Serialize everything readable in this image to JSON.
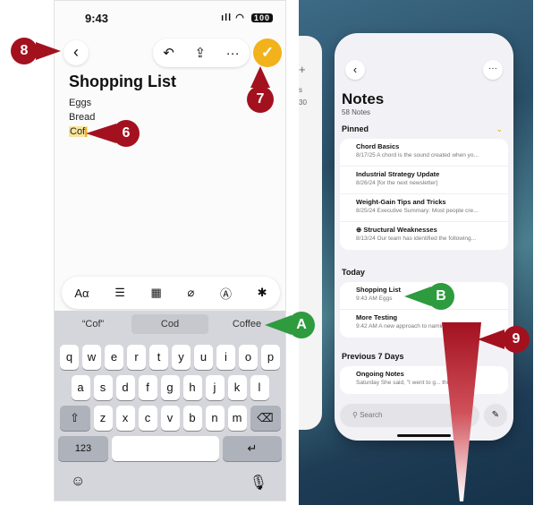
{
  "status": {
    "time": "9:43",
    "signal": "ıll",
    "wifi": "◠",
    "battery": "100"
  },
  "note": {
    "title": "Shopping List",
    "lines": [
      "Eggs",
      "Bread",
      "Cof"
    ]
  },
  "toolbar": {
    "undo_glyph": "↶",
    "share_glyph": "⇪",
    "more_glyph": "···",
    "done_glyph": "✓",
    "back_glyph": "‹"
  },
  "format_bar": {
    "aa": "Aα",
    "list_glyph": "☰",
    "table_glyph": "▦",
    "attach_glyph": "⌀",
    "markup_glyph": "Ⓐ",
    "ai_glyph": "✱"
  },
  "predictions": [
    "“Cof”",
    "Cod",
    "Coffee"
  ],
  "keyboard": {
    "row1": [
      "q",
      "w",
      "e",
      "r",
      "t",
      "y",
      "u",
      "i",
      "o",
      "p"
    ],
    "row2": [
      "a",
      "s",
      "d",
      "f",
      "g",
      "h",
      "j",
      "k",
      "l"
    ],
    "row3": [
      "z",
      "x",
      "c",
      "v",
      "b",
      "n",
      "m"
    ],
    "shift_glyph": "⇧",
    "delete_glyph": "⌫",
    "numbers_label": "123",
    "return_glyph": "↵",
    "emoji_glyph": "☺",
    "mic_glyph": "🎙"
  },
  "notes_app": {
    "title": "Notes",
    "count": "58 Notes",
    "pinned_label": "Pinned",
    "today_label": "Today",
    "prev7_label": "Previous 7 Days",
    "search_placeholder": "Search",
    "pinned": [
      {
        "title": "Chord Basics",
        "sub": "8/17/25  A chord is the sound created when yo..."
      },
      {
        "title": "Industrial Strategy Update",
        "sub": "8/26/24  [for the next newsletter]"
      },
      {
        "title": "Weight-Gain Tips and Tricks",
        "sub": "8/25/24  Executive Summary: Most people cre..."
      },
      {
        "title": "⊕ Structural Weaknesses",
        "sub": "8/13/24  Our team has identified the following..."
      }
    ],
    "today": [
      {
        "title": "Shopping List",
        "sub": "9:43 AM  Eggs"
      },
      {
        "title": "More Testing",
        "sub": "9:42 AM  A new approach to naming things o..."
      }
    ],
    "prev7": [
      {
        "title": "Ongoing Notes",
        "sub": "Saturday  She said, \"I went to g...  this next..."
      }
    ]
  },
  "bg_card": {
    "plus": "+",
    "s": "s",
    "thirty": "30"
  },
  "callouts": {
    "c8": "8",
    "c7": "7",
    "c6": "6",
    "cA": "A",
    "cB": "B",
    "c9": "9"
  },
  "colors": {
    "callout_red": "#a3111f",
    "callout_green": "#2e9b3e",
    "accent": "#f2b21c"
  }
}
